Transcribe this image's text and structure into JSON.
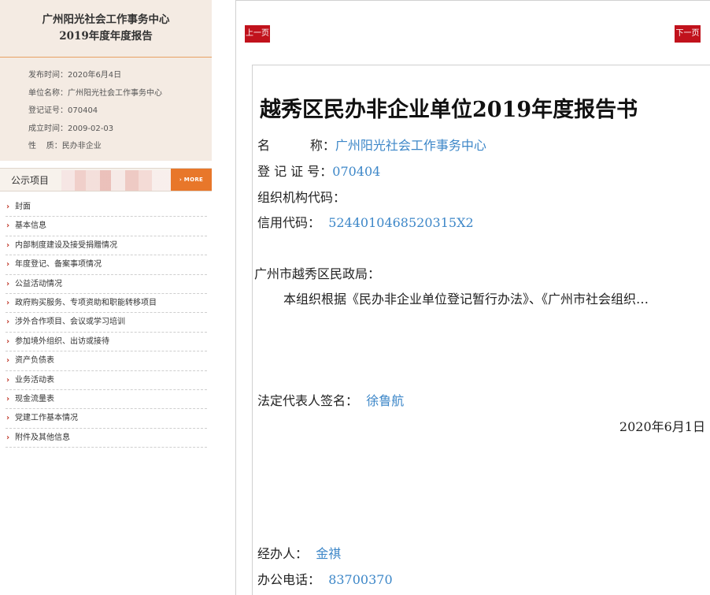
{
  "sidebar": {
    "org_title_line1": "广州阳光社会工作事务中心",
    "org_title_line2": "2019年度年度报告",
    "info": [
      {
        "label": "发布时间：",
        "value": "2020年6月4日"
      },
      {
        "label": "单位名称：",
        "value": "广州阳光社会工作事务中心"
      },
      {
        "label": "登记证号：",
        "value": "070404"
      },
      {
        "label": "成立时间：",
        "value": "2009-02-03"
      },
      {
        "label": "性    质：",
        "value": "民办非企业"
      }
    ],
    "section_title": "公示项目",
    "more_label": "› MORE",
    "menu": [
      "封面",
      "基本信息",
      "内部制度建设及接受捐赠情况",
      "年度登记、备案事项情况",
      "公益活动情况",
      "政府购买服务、专项资助和职能转移项目",
      "涉外合作项目、会议或学习培训",
      "参加境外组织、出访或接待",
      "资产负债表",
      "业务活动表",
      "现金流量表",
      "党建工作基本情况",
      "附件及其他信息"
    ],
    "menu_arrow": "›"
  },
  "nav": {
    "prev_label": "上一页",
    "next_label": "下一页"
  },
  "doc": {
    "title": "越秀区民办非企业单位2019年度报告书",
    "name_label": "名          称：",
    "name_value": "广州阳光社会工作事务中心",
    "reg_label": "登 记 证 号：",
    "reg_value": "070404",
    "org_code_label": "组织机构代码：",
    "credit_label": "信用代码：",
    "credit_value": "5244010468520315X2",
    "addressee": "广州市越秀区民政局：",
    "body": "本组织根据《民办非企业单位登记暂行办法》、《广州市社会组织…",
    "rep_label": "法定代表人签名：",
    "rep_value": "徐鲁航",
    "date": "2020年6月1日",
    "handler_label": "经办人：",
    "handler_value": "金祺",
    "phone_label": "办公电话：",
    "phone_value": "83700370"
  },
  "colors": {
    "accent_red": "#c1121c",
    "more_orange": "#e8772a",
    "link_blue": "#3d87c8",
    "panel_beige": "#f4ebe3"
  }
}
